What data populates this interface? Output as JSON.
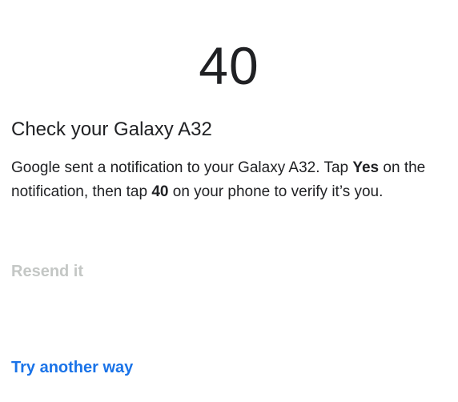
{
  "verification": {
    "number": "40"
  },
  "heading": "Check your Galaxy A32",
  "message": {
    "part1": "Google sent a notification to your Galaxy A32. Tap ",
    "yes": "Yes",
    "part2": " on the notification, then tap ",
    "number": "40",
    "part3": " on your phone to verify it’s you."
  },
  "actions": {
    "resend_label": "Resend it",
    "try_another_label": "Try another way"
  },
  "colors": {
    "text": "#202124",
    "link": "#1a73e8",
    "disabled": "#c4c7c5"
  }
}
